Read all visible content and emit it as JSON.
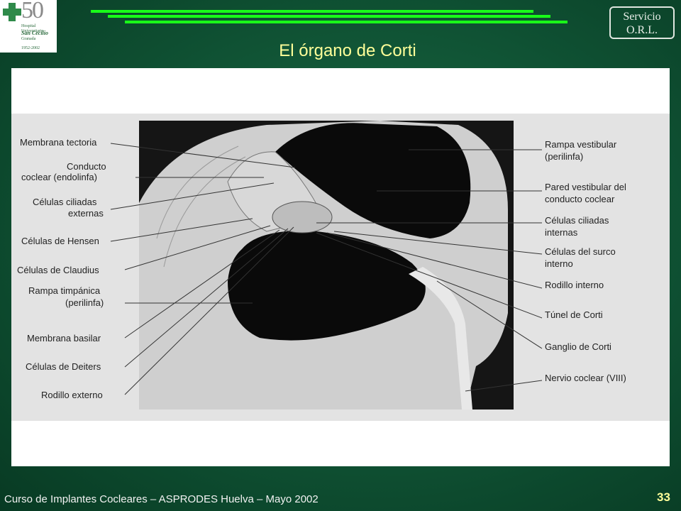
{
  "logo": {
    "number": "50",
    "line1": "Hospital Universitario",
    "line2": "San Cecilio",
    "line3": "Granada",
    "years": "1952-2002"
  },
  "service_badge": {
    "line1": "Servicio",
    "line2": "O.R.L."
  },
  "slide_title": "El órgano de Corti",
  "labels_left": [
    "Membrana tectoria",
    "Conducto",
    "coclear (endolinfa)",
    "Células ciliadas",
    "externas",
    "Células de Hensen",
    "Células de Claudius",
    "Rampa timpánica",
    "(perilinfa)",
    "Membrana basilar",
    "Células de Deiters",
    "Rodillo externo"
  ],
  "labels_right": [
    "Rampa vestibular",
    "(perilinfa)",
    "Pared vestibular del",
    "conducto coclear",
    "Células ciliadas",
    "internas",
    "Células del surco",
    "interno",
    "Rodillo interno",
    "Túnel de Corti",
    "Ganglio de Corti",
    "Nervio coclear (VIII)"
  ],
  "footer": "Curso de Implantes Cocleares – ASPRODES Huelva – Mayo 2002",
  "page_number": "33"
}
